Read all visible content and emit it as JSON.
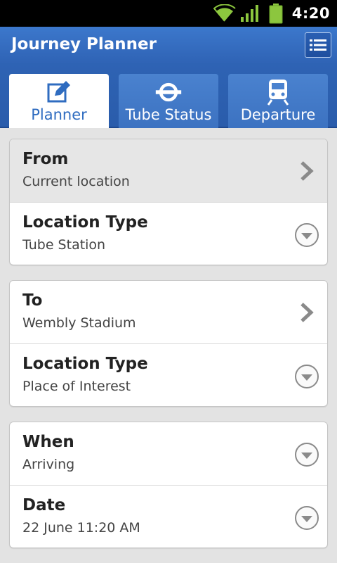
{
  "status_bar": {
    "time": "4:20",
    "icons": [
      "wifi-icon",
      "signal-icon",
      "battery-icon"
    ]
  },
  "action_bar": {
    "title": "Journey Planner",
    "menu_icon": "list-icon"
  },
  "tabs": [
    {
      "label": "Planner",
      "icon": "edit-icon",
      "selected": true
    },
    {
      "label": "Tube Status",
      "icon": "underground-roundel-icon",
      "selected": false
    },
    {
      "label": "Departure",
      "icon": "train-icon",
      "selected": false
    }
  ],
  "from_card": {
    "from": {
      "title": "From",
      "value": "Current location"
    },
    "location_type": {
      "title": "Location Type",
      "value": "Tube Station"
    }
  },
  "to_card": {
    "to": {
      "title": "To",
      "value": "Wembly Stadium"
    },
    "location_type": {
      "title": "Location Type",
      "value": "Place of Interest"
    }
  },
  "when_card": {
    "when": {
      "title": "When",
      "value": "Arriving"
    },
    "date": {
      "title": "Date",
      "value": "22 June 11:20 AM"
    }
  },
  "colors": {
    "action_bar": "#2f63b5",
    "tab_active_text": "#2f6cc0",
    "background": "#e3e3e3",
    "battery": "#8cc63e"
  }
}
